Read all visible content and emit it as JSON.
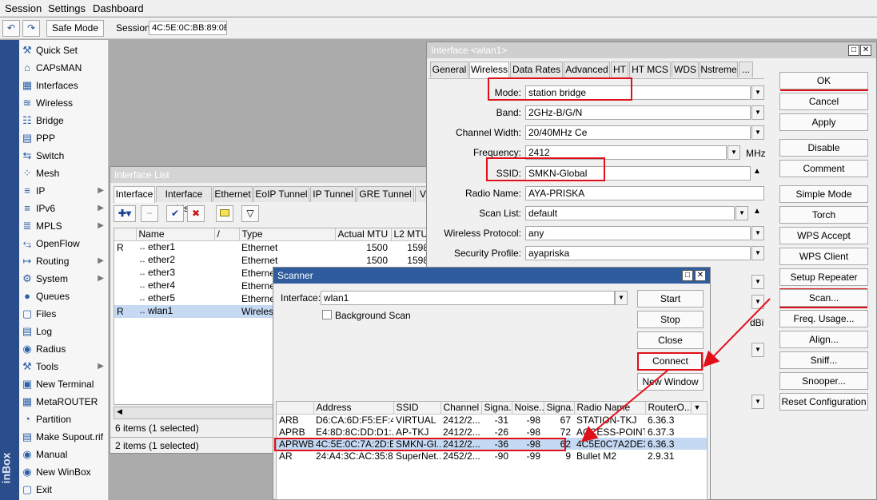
{
  "menubar": {
    "session": "Session",
    "settings": "Settings",
    "dashboard": "Dashboard"
  },
  "toolbar": {
    "safe_mode": "Safe Mode",
    "session_label": "Session:",
    "session_value": "4C:5E:0C:BB:89:0E"
  },
  "vertical_brand": "inBox",
  "sidebar": {
    "items": [
      {
        "label": "Quick Set",
        "icon": "quick-set-icon",
        "sub": false
      },
      {
        "label": "CAPsMAN",
        "icon": "capsman-icon",
        "sub": false
      },
      {
        "label": "Interfaces",
        "icon": "interfaces-icon",
        "sub": false
      },
      {
        "label": "Wireless",
        "icon": "wireless-icon",
        "sub": false
      },
      {
        "label": "Bridge",
        "icon": "bridge-icon",
        "sub": false
      },
      {
        "label": "PPP",
        "icon": "ppp-icon",
        "sub": false
      },
      {
        "label": "Switch",
        "icon": "switch-icon",
        "sub": false
      },
      {
        "label": "Mesh",
        "icon": "mesh-icon",
        "sub": false
      },
      {
        "label": "IP",
        "icon": "ip-icon",
        "sub": true
      },
      {
        "label": "IPv6",
        "icon": "ipv6-icon",
        "sub": true
      },
      {
        "label": "MPLS",
        "icon": "mpls-icon",
        "sub": true
      },
      {
        "label": "OpenFlow",
        "icon": "openflow-icon",
        "sub": false
      },
      {
        "label": "Routing",
        "icon": "routing-icon",
        "sub": true
      },
      {
        "label": "System",
        "icon": "system-icon",
        "sub": true
      },
      {
        "label": "Queues",
        "icon": "queues-icon",
        "sub": false
      },
      {
        "label": "Files",
        "icon": "files-icon",
        "sub": false
      },
      {
        "label": "Log",
        "icon": "log-icon",
        "sub": false
      },
      {
        "label": "Radius",
        "icon": "radius-icon",
        "sub": false
      },
      {
        "label": "Tools",
        "icon": "tools-icon",
        "sub": true
      },
      {
        "label": "New Terminal",
        "icon": "terminal-icon",
        "sub": false
      },
      {
        "label": "MetaROUTER",
        "icon": "metarouter-icon",
        "sub": false
      },
      {
        "label": "Partition",
        "icon": "partition-icon",
        "sub": false
      },
      {
        "label": "Make Supout.rif",
        "icon": "supout-icon",
        "sub": false
      },
      {
        "label": "Manual",
        "icon": "manual-icon",
        "sub": false
      },
      {
        "label": "New WinBox",
        "icon": "winbox-icon",
        "sub": false
      },
      {
        "label": "Exit",
        "icon": "exit-icon",
        "sub": false
      }
    ]
  },
  "interface_list": {
    "title": "Interface List",
    "tabs": [
      "Interface",
      "Interface List",
      "Ethernet",
      "EoIP Tunnel",
      "IP Tunnel",
      "GRE Tunnel",
      "V"
    ],
    "columns": [
      "",
      "Name",
      "/",
      "Type",
      "Actual MTU",
      "L2 MTU",
      "Tx"
    ],
    "rows": [
      {
        "flag": "R",
        "name": "ether1",
        "type": "Ethernet",
        "mtu": "1500",
        "l2mtu": "1598"
      },
      {
        "flag": "",
        "name": "ether2",
        "type": "Ethernet",
        "mtu": "1500",
        "l2mtu": "1598"
      },
      {
        "flag": "",
        "name": "ether3",
        "type": "Ethernet",
        "mtu": "",
        "l2mtu": ""
      },
      {
        "flag": "",
        "name": "ether4",
        "type": "Ethernet",
        "mtu": "",
        "l2mtu": ""
      },
      {
        "flag": "",
        "name": "ether5",
        "type": "Ethernet",
        "mtu": "",
        "l2mtu": ""
      },
      {
        "flag": "R",
        "name": "wlan1",
        "type": "Wireless (Ather",
        "mtu": "",
        "l2mtu": ""
      }
    ],
    "status1": "6 items (1 selected)",
    "status2": "2 items (1 selected)"
  },
  "interface_window": {
    "title": "Interface <wlan1>",
    "tabs": [
      "General",
      "Wireless",
      "Data Rates",
      "Advanced",
      "HT",
      "HT MCS",
      "WDS",
      "Nstreme",
      "..."
    ],
    "fields": {
      "mode_label": "Mode:",
      "mode": "station bridge",
      "band_label": "Band:",
      "band": "2GHz-B/G/N",
      "channel_width_label": "Channel Width:",
      "channel_width": "20/40MHz Ce",
      "frequency_label": "Frequency:",
      "frequency": "2412",
      "frequency_unit": "MHz",
      "ssid_label": "SSID:",
      "ssid": "SMKN-Global",
      "radio_name_label": "Radio Name:",
      "radio_name": "AYA-PRISKA",
      "scan_list_label": "Scan List:",
      "scan_list": "default",
      "wireless_protocol_label": "Wireless Protocol:",
      "wireless_protocol": "any",
      "security_profile_label": "Security Profile:",
      "security_profile": "ayapriska",
      "antenna_gain_unit": "dBi"
    },
    "buttons": [
      "OK",
      "Cancel",
      "Apply",
      "Disable",
      "Comment",
      "Simple Mode",
      "Torch",
      "WPS Accept",
      "WPS Client",
      "Setup Repeater",
      "Scan...",
      "Freq. Usage...",
      "Align...",
      "Sniff...",
      "Snooper...",
      "Reset Configuration"
    ]
  },
  "scanner": {
    "title": "Scanner",
    "interface_label": "Interface:",
    "interface_value": "wlan1",
    "background_scan": "Background Scan",
    "buttons": {
      "start": "Start",
      "stop": "Stop",
      "close": "Close",
      "connect": "Connect",
      "new_window": "New Window"
    },
    "columns": [
      "",
      "Address",
      "SSID",
      "Channel",
      "Signa...",
      "Noise...",
      "Signa...",
      "Radio Name",
      "RouterO..."
    ],
    "rows": [
      {
        "flags": "ARB",
        "address": "D6:CA:6D:F5:EF:49",
        "ssid": "VIRTUAL",
        "channel": "2412/2...",
        "signal": "-31",
        "noise": "-98",
        "snr": "67",
        "radio": "STATION-TKJ",
        "ros": "6.36.3"
      },
      {
        "flags": "APRB",
        "address": "E4:8D:8C:DD:D1:...",
        "ssid": "AP-TKJ",
        "channel": "2412/2...",
        "signal": "-26",
        "noise": "-98",
        "snr": "72",
        "radio": "ACCESS-POINT",
        "ros": "6.37.3"
      },
      {
        "flags": "APRWB",
        "address": "4C:5E:0C:7A:2D:E3",
        "ssid": "SMKN-Gl...",
        "channel": "2412/2...",
        "signal": "-36",
        "noise": "-98",
        "snr": "62",
        "radio": "4C5E0C7A2DE3",
        "ros": "6.36.3"
      },
      {
        "flags": "AR",
        "address": "24:A4:3C:AC:35:84",
        "ssid": "SuperNet...",
        "channel": "2452/2...",
        "signal": "-90",
        "noise": "-99",
        "snr": "9",
        "radio": "Bullet M2",
        "ros": "2.9.31"
      }
    ]
  },
  "colors": {
    "highlight": "#e0101a",
    "title_active": "#2e5c9d",
    "selection": "#c5d9f3"
  }
}
